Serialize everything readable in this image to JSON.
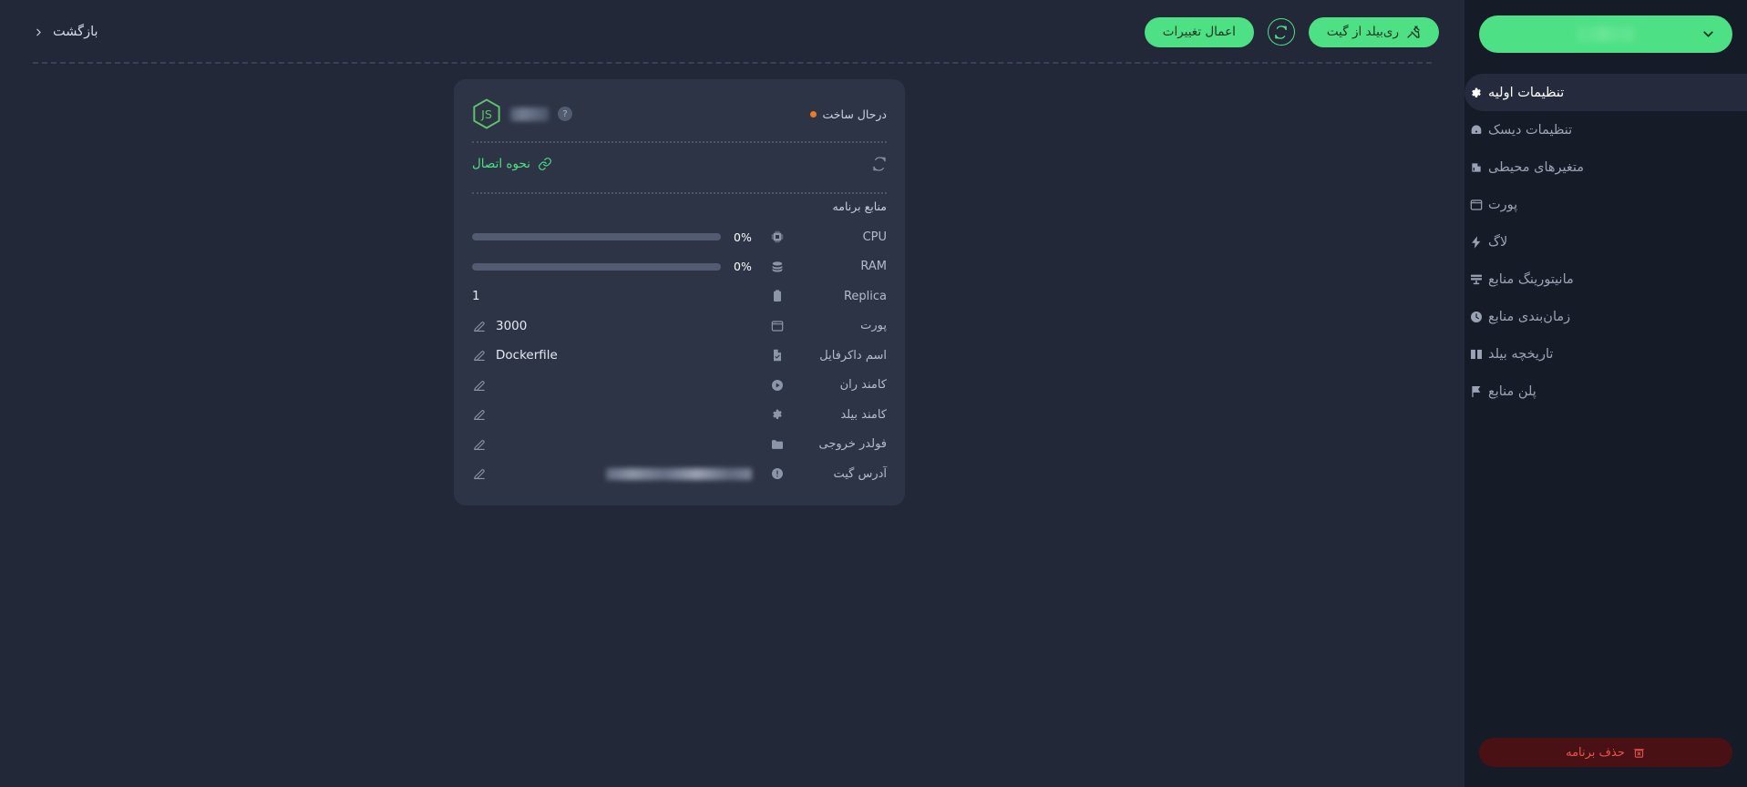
{
  "theme": {
    "page_bg": "#222838",
    "sidebar_bg": "#161b28",
    "card_bg": "#2c3446",
    "accent_green": "#4ee084",
    "danger_red": "#e5544f",
    "status_orange": "#f07a23",
    "muted_text": "#9aa3b5"
  },
  "sidebar": {
    "project_select": {
      "label": "",
      "value_hidden": true,
      "chevron_icon": "chevron-down-icon"
    },
    "items": [
      {
        "label": "تنظیمات اولیه",
        "icon": "gear-icon",
        "active": true
      },
      {
        "label": "تنظیمات دیسک",
        "icon": "disk-icon",
        "active": false
      },
      {
        "label": "متغیرهای محیطی",
        "icon": "memory-icon",
        "active": false
      },
      {
        "label": "پورت",
        "icon": "window-icon",
        "active": false
      },
      {
        "label": "لاگ",
        "icon": "bolt-icon",
        "active": false
      },
      {
        "label": "مانیتورینگ منابع",
        "icon": "monitor-icon",
        "active": false
      },
      {
        "label": "زمان‌بندی منابع",
        "icon": "clock-icon",
        "active": false
      },
      {
        "label": "تاریخچه بیلد",
        "icon": "book-icon",
        "active": false
      },
      {
        "label": "پلن منابع",
        "icon": "flag-icon",
        "active": false
      }
    ],
    "delete_button": {
      "label": "حذف برنامه",
      "icon": "trash-x-icon"
    }
  },
  "topbar": {
    "back_link": {
      "label": "بازگشت",
      "icon": "chevron-left-icon"
    },
    "apply_changes": {
      "label": "اعمال تغییرات"
    },
    "refresh": {
      "icon": "refresh-icon"
    },
    "rebuild_from_git": {
      "label": "ری‌بیلد از گیت",
      "icon": "tools-icon"
    }
  },
  "card": {
    "runtime_logo": "nodejs-logo",
    "app_name_hidden": true,
    "help_icon": "help-circle-icon",
    "status": {
      "label": "درحال ساخت",
      "dot_color": "#f07a23"
    },
    "connect_link": {
      "label": "نحوه اتصال",
      "icon": "link-icon"
    },
    "refresh_icon": "refresh-icon",
    "section_title": "منابع برنامه",
    "rows": [
      {
        "label": "CPU",
        "icon": "cpu-icon",
        "type": "progress",
        "value": 0,
        "display": "0%",
        "editable": false
      },
      {
        "label": "RAM",
        "icon": "ram-icon",
        "type": "progress",
        "value": 0,
        "display": "0%",
        "editable": false
      },
      {
        "label": "Replica",
        "icon": "clipboard-icon",
        "type": "text",
        "display": "1",
        "editable": false
      },
      {
        "label": "پورت",
        "icon": "window-icon",
        "type": "text",
        "display": "3000",
        "editable": true
      },
      {
        "label": "اسم داکرفایل",
        "icon": "file-check-icon",
        "type": "text",
        "display": "Dockerfile",
        "editable": true
      },
      {
        "label": "کامند ران",
        "icon": "play-icon",
        "type": "text",
        "display": "",
        "editable": true
      },
      {
        "label": "کامند بیلد",
        "icon": "gear-icon",
        "type": "text",
        "display": "",
        "editable": true
      },
      {
        "label": "فولدر خروجی",
        "icon": "folder-icon",
        "type": "text",
        "display": "",
        "editable": true
      },
      {
        "label": "آدرس گیت",
        "icon": "info-icon",
        "type": "blurred",
        "display": "",
        "editable": true
      }
    ]
  }
}
